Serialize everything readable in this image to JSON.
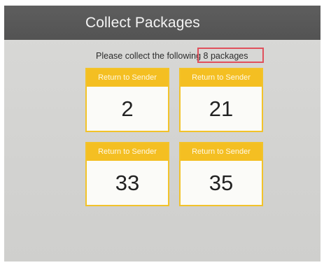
{
  "header": {
    "title": "Collect Packages"
  },
  "instruction": {
    "text": "Please collect the following 8 packages",
    "highlighted_text": "8 packages"
  },
  "packages": [
    {
      "label": "Return to Sender",
      "number": "2"
    },
    {
      "label": "Return to Sender",
      "number": "21"
    },
    {
      "label": "Return to Sender",
      "number": "33"
    },
    {
      "label": "Return to Sender",
      "number": "35"
    }
  ],
  "colors": {
    "title_bar": "#575757",
    "card_accent": "#f4bf22",
    "highlight": "#e0505c"
  }
}
